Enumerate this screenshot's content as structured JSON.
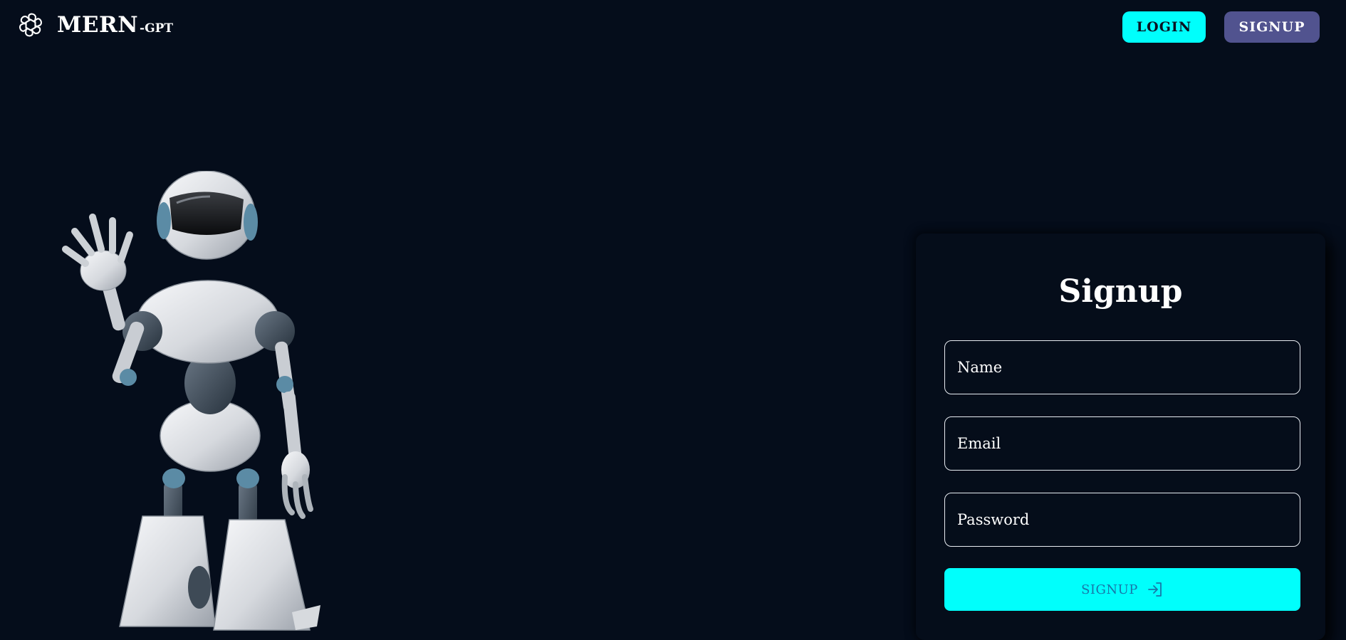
{
  "brand": {
    "icon": "openai-logo-icon",
    "name": "MERN",
    "suffix": "-GPT"
  },
  "nav": {
    "login_label": "LOGIN",
    "signup_label": "SIGNUP"
  },
  "form": {
    "title": "Signup",
    "name_placeholder": "Name",
    "email_placeholder": "Email",
    "password_placeholder": "Password",
    "submit_label": "SIGNUP",
    "submit_icon": "login-arrow-icon"
  },
  "colors": {
    "background": "#050d1b",
    "accent": "#00fffc",
    "signup_nav": "#51538f"
  }
}
